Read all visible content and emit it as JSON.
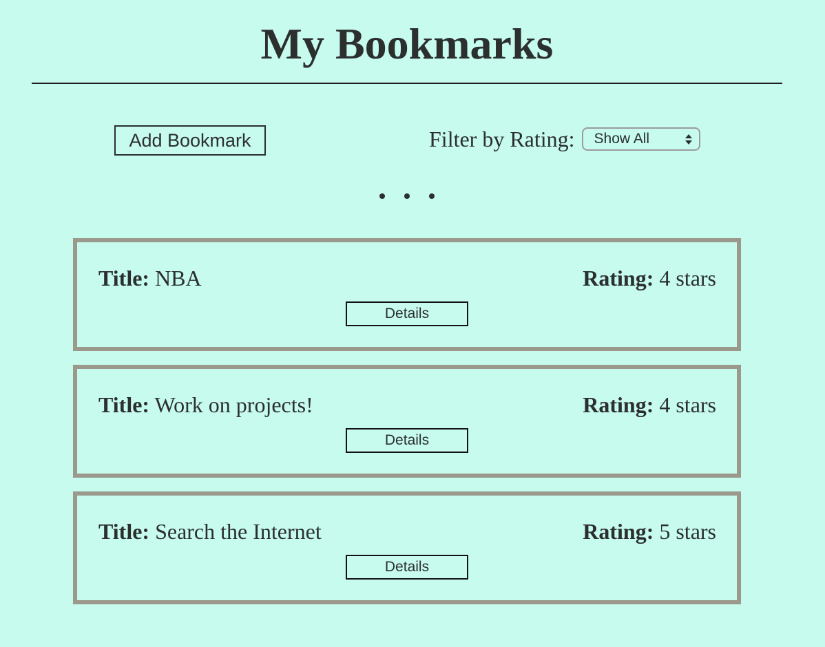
{
  "header": {
    "title": "My Bookmarks"
  },
  "controls": {
    "add_label": "Add Bookmark",
    "filter_label": "Filter by Rating:",
    "filter_selected": "Show All"
  },
  "bookmarks": [
    {
      "title_key": "Title:",
      "title": "NBA",
      "rating_key": "Rating:",
      "rating": "4 stars",
      "details_label": "Details"
    },
    {
      "title_key": "Title:",
      "title": "Work on projects!",
      "rating_key": "Rating:",
      "rating": "4 stars",
      "details_label": "Details"
    },
    {
      "title_key": "Title:",
      "title": "Search the Internet",
      "rating_key": "Rating:",
      "rating": "5 stars",
      "details_label": "Details"
    }
  ],
  "colors": {
    "background": "#c7fbee",
    "text": "#2b2f2e",
    "card_border": "#9a998c"
  },
  "icons": {
    "dots": "ellipsis-icon",
    "select_arrows": "select-arrows-icon"
  }
}
